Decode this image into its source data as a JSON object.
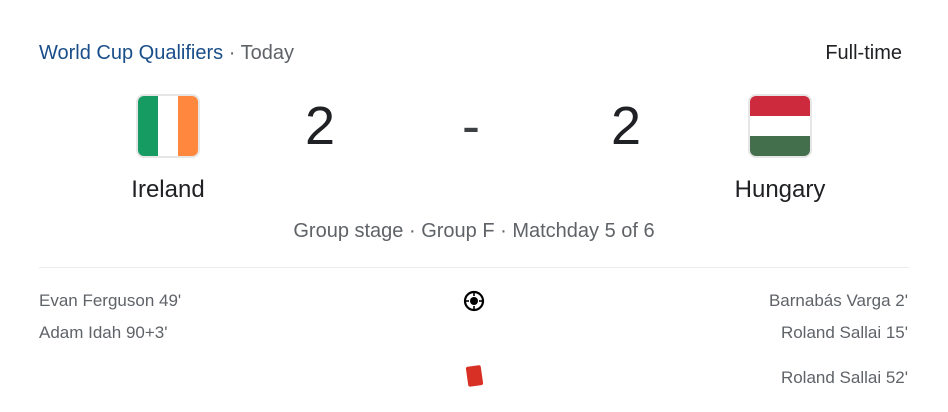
{
  "header": {
    "competition": "World Cup Qualifiers",
    "separator": "·",
    "date": "Today",
    "status": "Full-time"
  },
  "home": {
    "name": "Ireland",
    "score": "2",
    "flag_colors": [
      "#169b62",
      "#ffffff",
      "#ff883e"
    ]
  },
  "away": {
    "name": "Hungary",
    "score": "2",
    "flag_colors": [
      "#cd2a3e",
      "#ffffff",
      "#436f4d"
    ]
  },
  "score_separator": "-",
  "stage": "Group stage · Group F · Matchday 5 of 6",
  "events": {
    "goal_icon": "soccer-ball-icon",
    "red_card_icon": "red-card-icon",
    "red_card_color": "#d93025",
    "home_goals": [
      "Evan Ferguson 49'",
      "Adam Idah 90+3'"
    ],
    "away_goals": [
      "Barnabás Varga 2'",
      "Roland Sallai 15'"
    ],
    "away_red_cards": [
      "Roland Sallai 52'"
    ]
  }
}
